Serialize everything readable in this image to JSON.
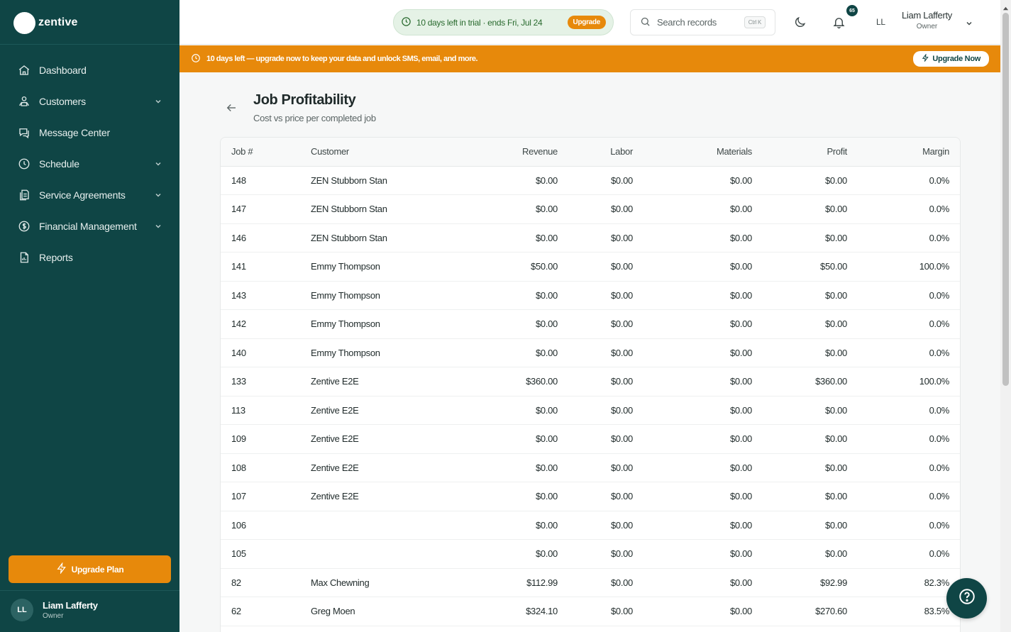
{
  "brand": {
    "name": "zentive"
  },
  "sidebar": {
    "items": [
      {
        "label": "Dashboard",
        "icon": "home-icon",
        "has_chevron": false
      },
      {
        "label": "Customers",
        "icon": "users-icon",
        "has_chevron": true
      },
      {
        "label": "Message Center",
        "icon": "chat-icon",
        "has_chevron": false
      },
      {
        "label": "Schedule",
        "icon": "clock-icon",
        "has_chevron": true
      },
      {
        "label": "Service Agreements",
        "icon": "file-stack-icon",
        "has_chevron": true
      },
      {
        "label": "Financial Management",
        "icon": "dollar-circle-icon",
        "has_chevron": true
      },
      {
        "label": "Reports",
        "icon": "report-icon",
        "has_chevron": false
      }
    ],
    "upgrade_label": "Upgrade Plan",
    "user": {
      "initials": "LL",
      "name": "Liam Lafferty",
      "role": "Owner"
    }
  },
  "topbar": {
    "trial_text": "10 days left in trial · ends Fri, Jul 24",
    "trial_upgrade": "Upgrade",
    "search_placeholder": "Search records",
    "search_shortcut": "Ctrl K",
    "notification_count": "65",
    "user_initials": "LL",
    "user_name": "Liam Lafferty",
    "user_role": "Owner"
  },
  "banner": {
    "text": "10 days left — upgrade now to keep your data and unlock SMS, email, and more.",
    "button": "Upgrade Now"
  },
  "page": {
    "title": "Job Profitability",
    "subtitle": "Cost vs price per completed job"
  },
  "table": {
    "columns": [
      "Job #",
      "Customer",
      "Revenue",
      "Labor",
      "Materials",
      "Profit",
      "Margin"
    ],
    "rows": [
      {
        "job": "148",
        "customer": "ZEN Stubborn Stan",
        "revenue": "$0.00",
        "labor": "$0.00",
        "materials": "$0.00",
        "profit": "$0.00",
        "margin": "0.0%"
      },
      {
        "job": "147",
        "customer": "ZEN Stubborn Stan",
        "revenue": "$0.00",
        "labor": "$0.00",
        "materials": "$0.00",
        "profit": "$0.00",
        "margin": "0.0%"
      },
      {
        "job": "146",
        "customer": "ZEN Stubborn Stan",
        "revenue": "$0.00",
        "labor": "$0.00",
        "materials": "$0.00",
        "profit": "$0.00",
        "margin": "0.0%"
      },
      {
        "job": "141",
        "customer": "Emmy Thompson",
        "revenue": "$50.00",
        "labor": "$0.00",
        "materials": "$0.00",
        "profit": "$50.00",
        "margin": "100.0%"
      },
      {
        "job": "143",
        "customer": "Emmy Thompson",
        "revenue": "$0.00",
        "labor": "$0.00",
        "materials": "$0.00",
        "profit": "$0.00",
        "margin": "0.0%"
      },
      {
        "job": "142",
        "customer": "Emmy Thompson",
        "revenue": "$0.00",
        "labor": "$0.00",
        "materials": "$0.00",
        "profit": "$0.00",
        "margin": "0.0%"
      },
      {
        "job": "140",
        "customer": "Emmy Thompson",
        "revenue": "$0.00",
        "labor": "$0.00",
        "materials": "$0.00",
        "profit": "$0.00",
        "margin": "0.0%"
      },
      {
        "job": "133",
        "customer": "Zentive E2E",
        "revenue": "$360.00",
        "labor": "$0.00",
        "materials": "$0.00",
        "profit": "$360.00",
        "margin": "100.0%"
      },
      {
        "job": "113",
        "customer": "Zentive E2E",
        "revenue": "$0.00",
        "labor": "$0.00",
        "materials": "$0.00",
        "profit": "$0.00",
        "margin": "0.0%"
      },
      {
        "job": "109",
        "customer": "Zentive E2E",
        "revenue": "$0.00",
        "labor": "$0.00",
        "materials": "$0.00",
        "profit": "$0.00",
        "margin": "0.0%"
      },
      {
        "job": "108",
        "customer": "Zentive E2E",
        "revenue": "$0.00",
        "labor": "$0.00",
        "materials": "$0.00",
        "profit": "$0.00",
        "margin": "0.0%"
      },
      {
        "job": "107",
        "customer": "Zentive E2E",
        "revenue": "$0.00",
        "labor": "$0.00",
        "materials": "$0.00",
        "profit": "$0.00",
        "margin": "0.0%"
      },
      {
        "job": "106",
        "customer": "",
        "revenue": "$0.00",
        "labor": "$0.00",
        "materials": "$0.00",
        "profit": "$0.00",
        "margin": "0.0%"
      },
      {
        "job": "105",
        "customer": "",
        "revenue": "$0.00",
        "labor": "$0.00",
        "materials": "$0.00",
        "profit": "$0.00",
        "margin": "0.0%"
      },
      {
        "job": "82",
        "customer": "Max Chewning",
        "revenue": "$112.99",
        "labor": "$0.00",
        "materials": "$0.00",
        "profit": "$92.99",
        "margin": "82.3%"
      },
      {
        "job": "62",
        "customer": "Greg Moen",
        "revenue": "$324.10",
        "labor": "$0.00",
        "materials": "$0.00",
        "profit": "$270.60",
        "margin": "83.5%"
      }
    ]
  },
  "colors": {
    "sidebar_bg": "#0f4545",
    "accent_orange": "#e7890b",
    "trial_green": "#2a6b2f"
  }
}
